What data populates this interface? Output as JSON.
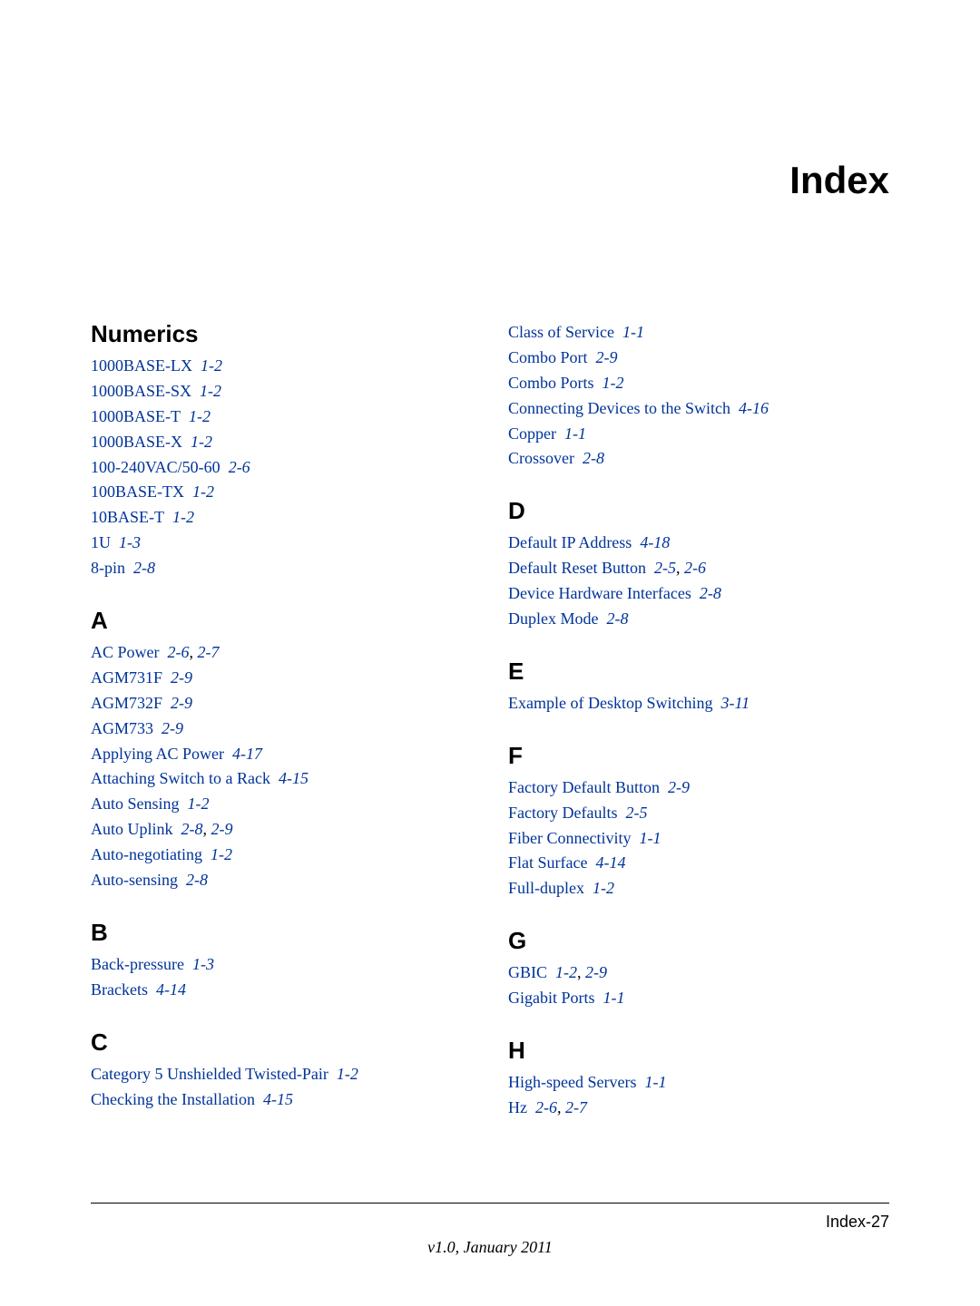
{
  "page_title": "Index",
  "footer": {
    "page_number": "Index-27",
    "version": "v1.0, January 2011"
  },
  "left_sections": [
    {
      "heading": "Numerics",
      "entries": [
        {
          "term": "1000BASE-LX",
          "refs": [
            "1-2"
          ]
        },
        {
          "term": "1000BASE-SX",
          "refs": [
            "1-2"
          ]
        },
        {
          "term": "1000BASE-T",
          "refs": [
            "1-2"
          ]
        },
        {
          "term": "1000BASE-X",
          "refs": [
            "1-2"
          ]
        },
        {
          "term": "100-240VAC/50-60",
          "refs": [
            "2-6"
          ]
        },
        {
          "term": "100BASE-TX",
          "refs": [
            "1-2"
          ]
        },
        {
          "term": "10BASE-T",
          "refs": [
            "1-2"
          ]
        },
        {
          "term": "1U",
          "refs": [
            "1-3"
          ]
        },
        {
          "term": "8-pin",
          "refs": [
            "2-8"
          ]
        }
      ]
    },
    {
      "heading": "A",
      "entries": [
        {
          "term": "AC Power",
          "refs": [
            "2-6",
            "2-7"
          ]
        },
        {
          "term": "AGM731F",
          "refs": [
            "2-9"
          ]
        },
        {
          "term": "AGM732F",
          "refs": [
            "2-9"
          ]
        },
        {
          "term": "AGM733",
          "refs": [
            "2-9"
          ]
        },
        {
          "term": "Applying AC Power",
          "refs": [
            "4-17"
          ]
        },
        {
          "term": "Attaching Switch to a Rack",
          "refs": [
            "4-15"
          ]
        },
        {
          "term": "Auto Sensing",
          "refs": [
            "1-2"
          ]
        },
        {
          "term": "Auto Uplink",
          "refs": [
            "2-8",
            "2-9"
          ]
        },
        {
          "term": "Auto-negotiating",
          "refs": [
            "1-2"
          ]
        },
        {
          "term": "Auto-sensing",
          "refs": [
            "2-8"
          ]
        }
      ]
    },
    {
      "heading": "B",
      "entries": [
        {
          "term": "Back-pressure",
          "refs": [
            "1-3"
          ]
        },
        {
          "term": "Brackets",
          "refs": [
            "4-14"
          ]
        }
      ]
    },
    {
      "heading": "C",
      "entries": [
        {
          "term": "Category 5 Unshielded Twisted-Pair",
          "refs": [
            "1-2"
          ]
        },
        {
          "term": "Checking the Installation",
          "refs": [
            "4-15"
          ]
        }
      ]
    }
  ],
  "right_sections": [
    {
      "heading": "",
      "entries": [
        {
          "term": "Class of Service",
          "refs": [
            "1-1"
          ]
        },
        {
          "term": "Combo Port",
          "refs": [
            "2-9"
          ]
        },
        {
          "term": "Combo Ports",
          "refs": [
            "1-2"
          ]
        },
        {
          "term": "Connecting Devices to the Switch",
          "refs": [
            "4-16"
          ]
        },
        {
          "term": "Copper",
          "refs": [
            "1-1"
          ]
        },
        {
          "term": "Crossover",
          "refs": [
            "2-8"
          ]
        }
      ]
    },
    {
      "heading": "D",
      "entries": [
        {
          "term": "Default IP Address",
          "refs": [
            "4-18"
          ]
        },
        {
          "term": "Default Reset Button",
          "refs": [
            "2-5",
            "2-6"
          ]
        },
        {
          "term": "Device Hardware Interfaces",
          "refs": [
            "2-8"
          ]
        },
        {
          "term": "Duplex Mode",
          "refs": [
            "2-8"
          ]
        }
      ]
    },
    {
      "heading": "E",
      "entries": [
        {
          "term": "Example of Desktop Switching",
          "refs": [
            "3-11"
          ]
        }
      ]
    },
    {
      "heading": "F",
      "entries": [
        {
          "term": "Factory Default Button",
          "refs": [
            "2-9"
          ]
        },
        {
          "term": "Factory Defaults",
          "refs": [
            "2-5"
          ]
        },
        {
          "term": "Fiber Connectivity",
          "refs": [
            "1-1"
          ]
        },
        {
          "term": "Flat Surface",
          "refs": [
            "4-14"
          ]
        },
        {
          "term": "Full-duplex",
          "refs": [
            "1-2"
          ]
        }
      ]
    },
    {
      "heading": "G",
      "entries": [
        {
          "term": "GBIC",
          "refs": [
            "1-2",
            "2-9"
          ]
        },
        {
          "term": "Gigabit Ports",
          "refs": [
            "1-1"
          ]
        }
      ]
    },
    {
      "heading": "H",
      "entries": [
        {
          "term": "High-speed Servers",
          "refs": [
            "1-1"
          ]
        },
        {
          "term": "Hz",
          "refs": [
            "2-6",
            "2-7"
          ]
        }
      ]
    }
  ]
}
